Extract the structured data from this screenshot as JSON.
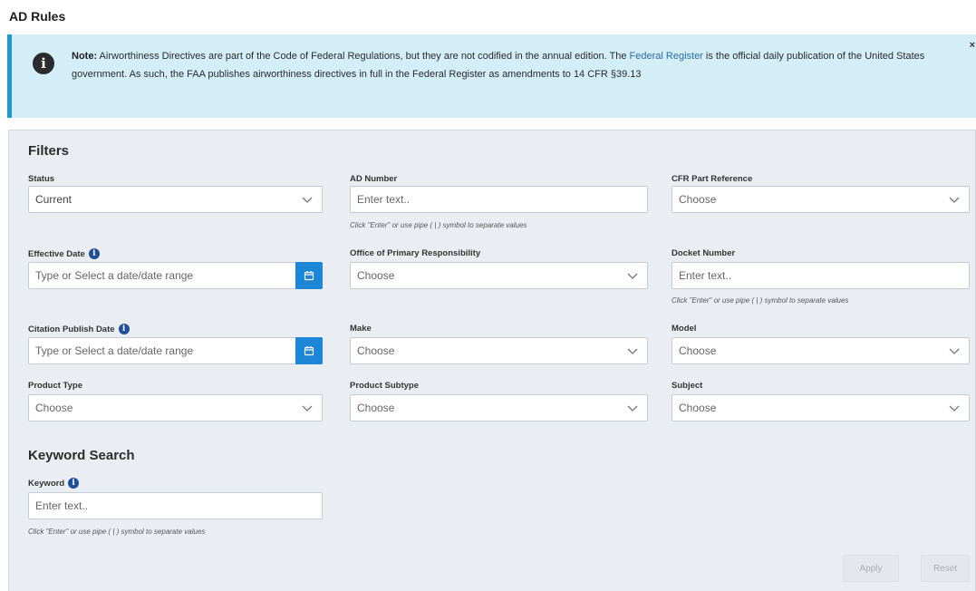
{
  "page_title": "AD Rules",
  "note": {
    "label": "Note:",
    "text_before_link": " Airworthiness Directives are part of the Code of Federal Regulations, but they are not codified in the annual edition. The ",
    "link_text": "Federal Register",
    "text_after_link": " is the official daily publication of the United States government. As such, the FAA publishes airworthiness directives in full in the Federal Register as amendments to 14 CFR §39.13",
    "close_label": "×"
  },
  "filters": {
    "title": "Filters",
    "status": {
      "label": "Status",
      "value": "Current"
    },
    "ad_number": {
      "label": "AD Number",
      "placeholder": "Enter text..",
      "hint": "Click \"Enter\" or use pipe ( | ) symbol to separate values"
    },
    "cfr_part": {
      "label": "CFR Part Reference",
      "value": "Choose"
    },
    "effective_date": {
      "label": "Effective Date",
      "placeholder": "Type or Select a date/date range"
    },
    "office": {
      "label": "Office of Primary Responsibility",
      "value": "Choose"
    },
    "docket_number": {
      "label": "Docket Number",
      "placeholder": "Enter text..",
      "hint": "Click \"Enter\" or use pipe ( | ) symbol to separate values"
    },
    "citation_date": {
      "label": "Citation Publish Date",
      "placeholder": "Type or Select a date/date range"
    },
    "make": {
      "label": "Make",
      "value": "Choose"
    },
    "model": {
      "label": "Model",
      "value": "Choose"
    },
    "product_type": {
      "label": "Product Type",
      "value": "Choose"
    },
    "product_subtype": {
      "label": "Product Subtype",
      "value": "Choose"
    },
    "subject": {
      "label": "Subject",
      "value": "Choose"
    }
  },
  "keyword_search": {
    "title": "Keyword Search",
    "label": "Keyword",
    "placeholder": "Enter text..",
    "hint": "Click \"Enter\" or use pipe ( | ) symbol to separate values"
  },
  "buttons": {
    "apply": "Apply",
    "reset": "Reset"
  }
}
